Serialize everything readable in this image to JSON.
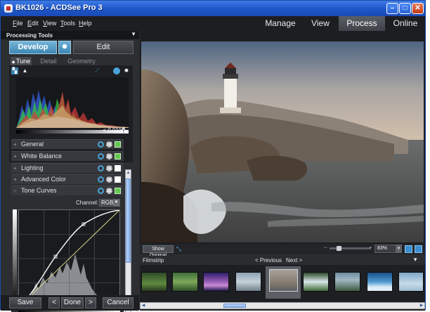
{
  "window": {
    "title": "BK1026 - ACDSee Pro 3",
    "minimize_icon": "minimize-icon",
    "maximize_icon": "maximize-icon",
    "close_icon": "close-icon"
  },
  "menu": [
    {
      "key": "F",
      "rest": "ile"
    },
    {
      "key": "E",
      "rest": "dit"
    },
    {
      "key": "V",
      "rest": "iew"
    },
    {
      "key": "T",
      "rest": "ools"
    },
    {
      "key": "H",
      "rest": "elp"
    }
  ],
  "modes": {
    "manage": "Manage",
    "view": "View",
    "process": "Process",
    "online": "Online",
    "active": "Process"
  },
  "left_panel": {
    "header": "Processing Tools",
    "develop": "Develop",
    "edit": "Edit",
    "subtabs": {
      "tune": "Tune",
      "detail": "Detail",
      "geometry": "Geometry"
    },
    "clipping": "< 0.01%",
    "sections": {
      "general": "General",
      "white_balance": "White Balance",
      "lighting": "Lighting",
      "advanced_color": "Advanced Color",
      "tone_curves": "Tone Curves"
    },
    "channel_label": "Channel:",
    "channel_value": "RGB"
  },
  "buttons": {
    "save": "Save",
    "prev": "<",
    "done": "Done",
    "next": ">",
    "cancel": "Cancel"
  },
  "viewer": {
    "show_original": "Show Original",
    "zoom": "83%"
  },
  "filmstrip": {
    "title": "Filmstrip",
    "previous": "< Previous",
    "next": "Next >",
    "thumb_count": 9,
    "selected_index": 4
  },
  "colors": {
    "accent": "#3d87b5",
    "titlebar": "#1d55c9",
    "panel": "#2c2e32"
  }
}
